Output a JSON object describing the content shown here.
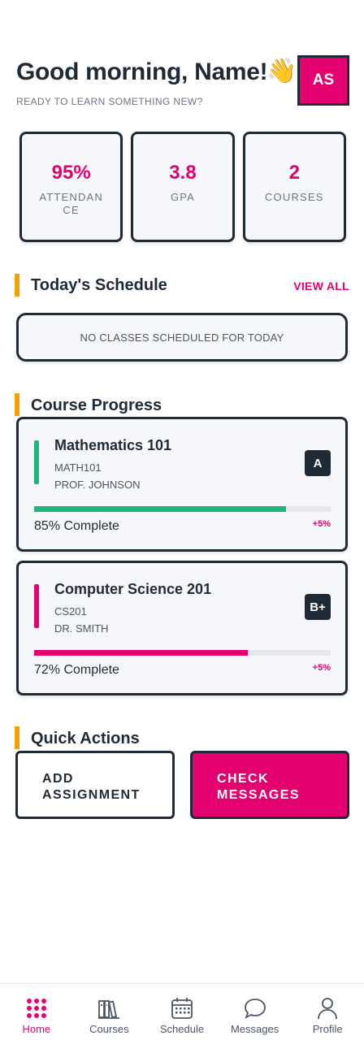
{
  "header": {
    "greeting": "Good morning, Name!",
    "wave_icon": "waving-hand-icon",
    "subtitle": "READY TO LEARN SOMETHING NEW?",
    "avatar_initials": "AS"
  },
  "stats": [
    {
      "value": "95%",
      "label": "ATTENDANCE"
    },
    {
      "value": "3.8",
      "label": "GPA"
    },
    {
      "value": "2",
      "label": "COURSES"
    }
  ],
  "schedule": {
    "title": "Today's Schedule",
    "view_all": "VIEW ALL",
    "empty_text": "NO CLASSES SCHEDULED FOR TODAY"
  },
  "progress": {
    "title": "Course Progress",
    "courses": [
      {
        "name": "Mathematics 101",
        "code": "MATH101",
        "instructor": "PROF. JOHNSON",
        "grade": "A",
        "percent": 85,
        "complete_text": "85% Complete",
        "delta": "+5%",
        "color": "#1db57a"
      },
      {
        "name": "Computer Science 201",
        "code": "CS201",
        "instructor": "DR. SMITH",
        "grade": "B+",
        "percent": 72,
        "complete_text": "72% Complete",
        "delta": "+5%",
        "color": "#e5006f"
      }
    ]
  },
  "quick_actions": {
    "title": "Quick Actions",
    "add_assignment": "ADD ASSIGNMENT",
    "check_messages": "CHECK MESSAGES"
  },
  "nav": {
    "items": [
      {
        "label": "Home",
        "icon": "grid-icon",
        "active": true
      },
      {
        "label": "Courses",
        "icon": "books-icon",
        "active": false
      },
      {
        "label": "Schedule",
        "icon": "calendar-icon",
        "active": false
      },
      {
        "label": "Messages",
        "icon": "chat-bubble-icon",
        "active": false
      },
      {
        "label": "Profile",
        "icon": "person-icon",
        "active": false
      }
    ]
  },
  "colors": {
    "accent": "#e5006f",
    "section_marker": "#f5a000",
    "dark": "#1f2a37"
  }
}
